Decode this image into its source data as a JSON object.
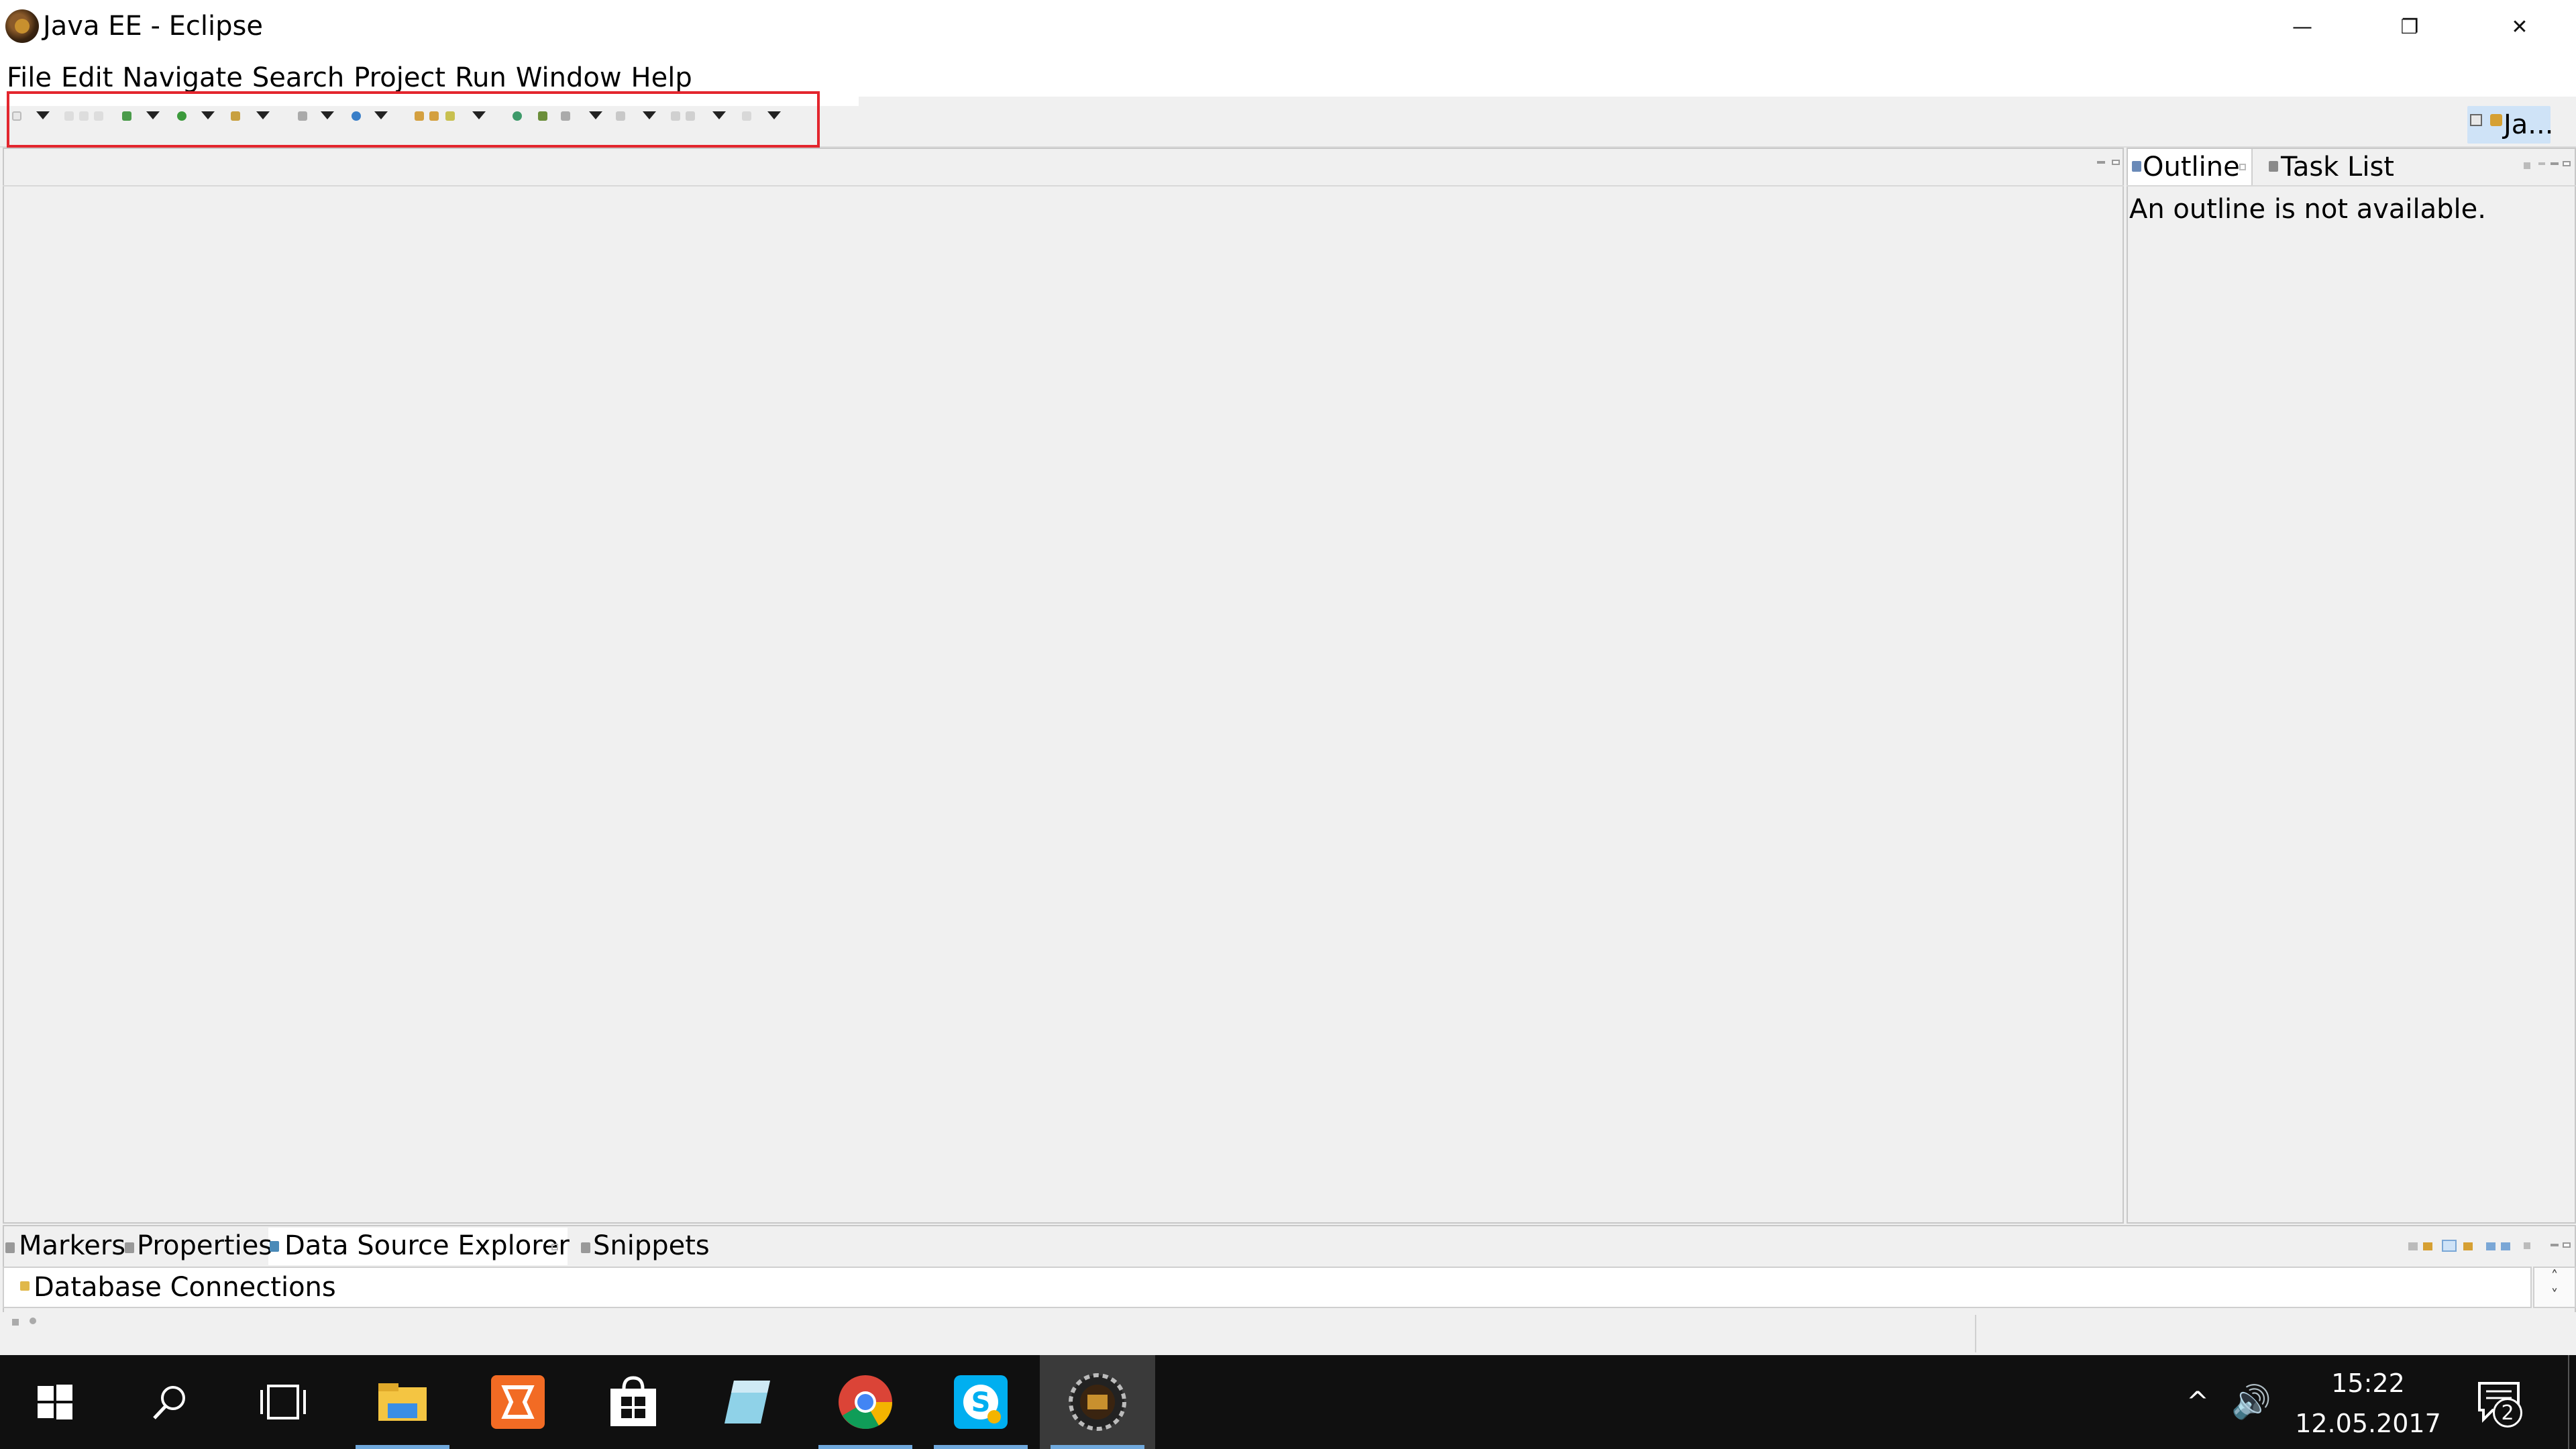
{
  "window": {
    "title": "Java EE - Eclipse",
    "minimize": "—",
    "restore": "❐",
    "close": "✕"
  },
  "menu": [
    "File",
    "Edit",
    "Navigate",
    "Search",
    "Project",
    "Run",
    "Window",
    "Help"
  ],
  "toolbar": {
    "highlight_color": "#e3262e",
    "perspective_label": "Ja..."
  },
  "outline_panel": {
    "tabs": [
      "Outline",
      "Task List"
    ],
    "message": "An outline is not available."
  },
  "bottom_panel": {
    "tabs": [
      "Markers",
      "Properties",
      "Data Source Explorer",
      "Snippets"
    ],
    "tree_item": "Database Connections",
    "scroll_up": "˄",
    "scroll_down": "˅"
  },
  "taskbar": {
    "time": "15:22",
    "date": "12.05.2017",
    "notification_count": "2",
    "tray_chevron": "^",
    "volume_icon": "🔊",
    "apps": [
      "start",
      "search",
      "task-view",
      "file-explorer",
      "xampp",
      "store",
      "notepad",
      "chrome",
      "skype",
      "eclipse-java-ee"
    ]
  }
}
